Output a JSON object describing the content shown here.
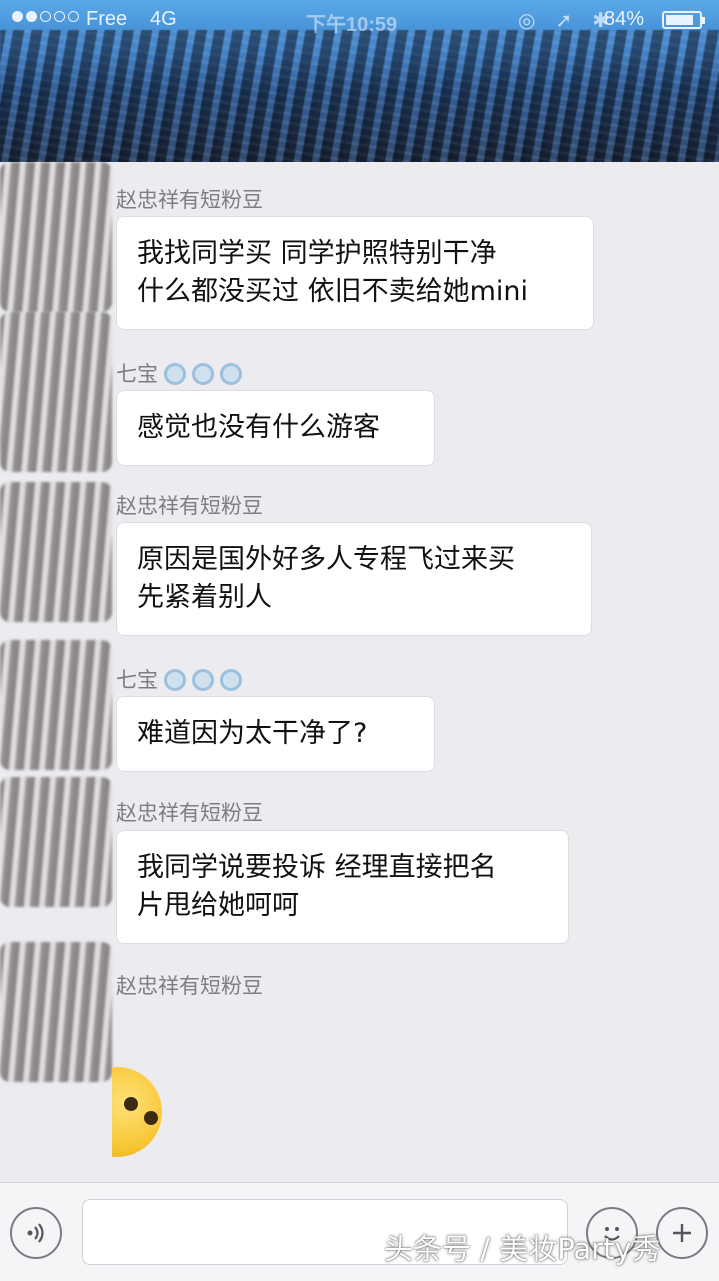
{
  "status_bar": {
    "carrier": "Free",
    "network": "4G",
    "time": "下午10:59",
    "battery_percent": "84%",
    "battery_level": 0.84
  },
  "messages": [
    {
      "sender": "赵忠祥有短粉豆",
      "text": "我找同学买 同学护照特别干净\n什么都没买过 依旧不卖给她mini"
    },
    {
      "sender": "七宝",
      "text": "感觉也没有什么游客"
    },
    {
      "sender": "赵忠祥有短粉豆",
      "text": "原因是国外好多人专程飞过来买\n先紧着别人"
    },
    {
      "sender": "七宝",
      "text": "难道因为太干净了?"
    },
    {
      "sender": "赵忠祥有短粉豆",
      "text": "我同学说要投诉 经理直接把名\n片甩给她呵呵"
    },
    {
      "sender": "赵忠祥有短粉豆",
      "text": ""
    }
  ],
  "input_bar": {
    "voice_icon": "voice-icon",
    "emoji_icon": "emoji-icon",
    "plus_icon": "plus-icon"
  },
  "watermark": "头条号 / 美妆Party秀"
}
